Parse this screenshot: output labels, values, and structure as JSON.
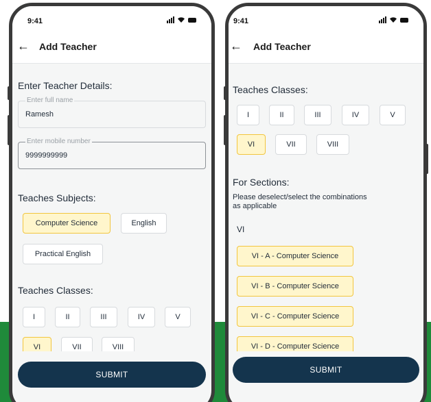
{
  "status_bar": {
    "time": "9:41"
  },
  "header": {
    "title": "Add Teacher"
  },
  "left": {
    "details_heading": "Enter Teacher Details:",
    "name_field": {
      "label": "Enter full name",
      "value": "Ramesh"
    },
    "mobile_field": {
      "label": "Enter mobile number",
      "value": "9999999999"
    },
    "subjects_heading": "Teaches Subjects:",
    "subjects": [
      {
        "label": "Computer Science",
        "selected": true
      },
      {
        "label": "English",
        "selected": false
      },
      {
        "label": "Practical English",
        "selected": false
      }
    ],
    "classes_heading": "Teaches Classes:",
    "classes": [
      {
        "label": "I",
        "selected": false
      },
      {
        "label": "II",
        "selected": false
      },
      {
        "label": "III",
        "selected": false
      },
      {
        "label": "IV",
        "selected": false
      },
      {
        "label": "V",
        "selected": false
      },
      {
        "label": "VI",
        "selected": true
      },
      {
        "label": "VII",
        "selected": false
      },
      {
        "label": "VIII",
        "selected": false
      }
    ],
    "submit_label": "SUBMIT"
  },
  "right": {
    "classes_heading": "Teaches Classes:",
    "classes": [
      {
        "label": "I",
        "selected": false
      },
      {
        "label": "II",
        "selected": false
      },
      {
        "label": "III",
        "selected": false
      },
      {
        "label": "IV",
        "selected": false
      },
      {
        "label": "V",
        "selected": false
      },
      {
        "label": "VI",
        "selected": true
      },
      {
        "label": "VII",
        "selected": false
      },
      {
        "label": "VIII",
        "selected": false
      }
    ],
    "sections_heading": "For Sections:",
    "sections_hint_line1": "Please deselect/select the combinations",
    "sections_hint_line2": "as applicable",
    "group_label": "VI",
    "combinations": [
      {
        "label": "VI - A - Computer Science",
        "selected": true
      },
      {
        "label": "VI - B - Computer Science",
        "selected": true
      },
      {
        "label": "VI - C - Computer Science",
        "selected": true
      },
      {
        "label": "VI - D - Computer Science",
        "selected": true
      }
    ],
    "submit_label": "SUBMIT"
  }
}
